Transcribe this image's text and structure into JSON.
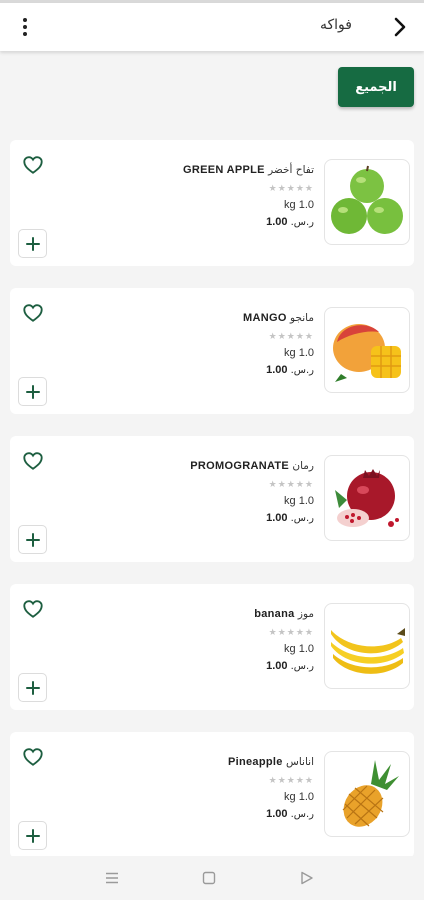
{
  "header": {
    "title": "فواكه",
    "back_icon": "chevron-right-icon",
    "menu_icon": "vertical-dots-icon"
  },
  "filter": {
    "all_label": "الجميع"
  },
  "colors": {
    "accent": "#166b42",
    "heart": "#1d5e40",
    "plus": "#1d5e40"
  },
  "products": [
    {
      "name_en": "GREEN APPLE",
      "name_ar": "تفاح أخضر",
      "stars": "★★★★★",
      "weight": "kg 1.0",
      "price": "1.00",
      "currency": "ر.س.",
      "image": "green-apple-image"
    },
    {
      "name_en": "MANGO",
      "name_ar": "مانجو",
      "stars": "★★★★★",
      "weight": "kg 1.0",
      "price": "1.00",
      "currency": "ر.س.",
      "image": "mango-image"
    },
    {
      "name_en": "PROMOGRANATE",
      "name_ar": "رمان",
      "stars": "★★★★★",
      "weight": "kg 1.0",
      "price": "1.00",
      "currency": "ر.س.",
      "image": "pomegranate-image"
    },
    {
      "name_en": "banana",
      "name_ar": "موز",
      "stars": "★★★★★",
      "weight": "kg 1.0",
      "price": "1.00",
      "currency": "ر.س.",
      "image": "banana-image"
    },
    {
      "name_en": "Pineapple",
      "name_ar": "اناناس",
      "stars": "★★★★★",
      "weight": "kg 1.0",
      "price": "1.00",
      "currency": "ر.س.",
      "image": "pineapple-image"
    }
  ],
  "system_nav": {
    "menu_icon": "recents-icon",
    "home_icon": "home-icon",
    "back_icon": "back-triangle-icon"
  }
}
